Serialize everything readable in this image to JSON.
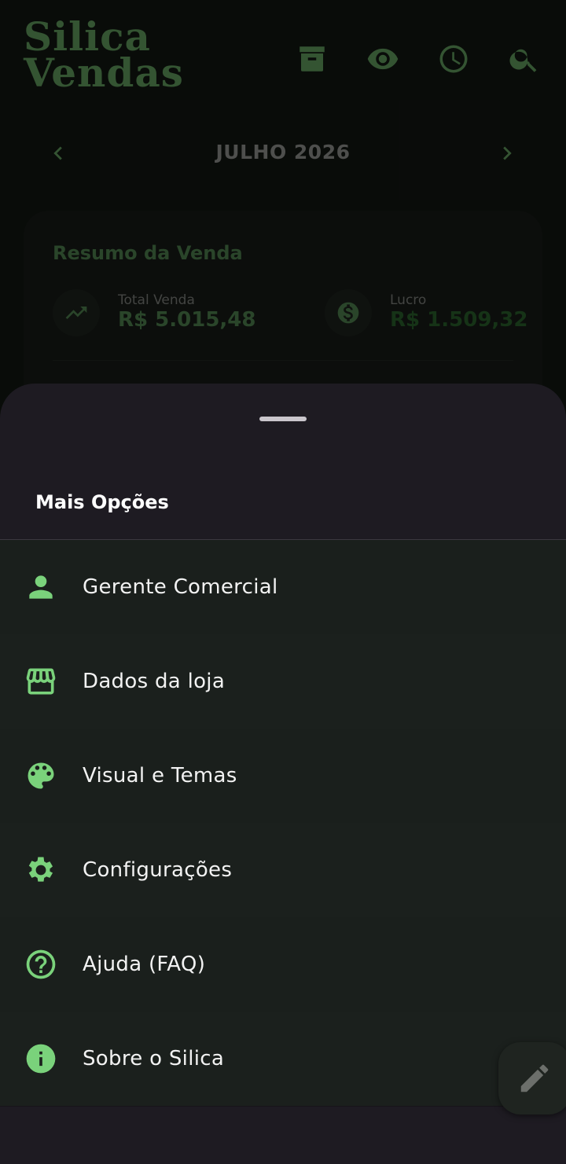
{
  "app": {
    "logo_line1": "Silica",
    "logo_line2": "Vendas",
    "brand_color": "#5f9a5c"
  },
  "top_icons": [
    "archive-icon",
    "eye-icon",
    "clock-icon",
    "search-icon"
  ],
  "month_nav": {
    "label": "JULHO 2026"
  },
  "summary": {
    "title": "Resumo da Venda",
    "total_label": "Total Venda",
    "total_value": "R$ 5.015,48",
    "profit_label": "Lucro",
    "profit_value": "R$ 1.509,32"
  },
  "sheet": {
    "title": "Mais Opções",
    "items": [
      {
        "label": "Gerente Comercial",
        "icon": "person-icon"
      },
      {
        "label": "Dados da loja",
        "icon": "store-icon"
      },
      {
        "label": "Visual e Temas",
        "icon": "palette-icon"
      },
      {
        "label": "Configurações",
        "icon": "gear-icon"
      },
      {
        "label": "Ajuda (FAQ)",
        "icon": "help-icon"
      },
      {
        "label": "Sobre o Silica",
        "icon": "info-icon"
      }
    ],
    "accent_color": "#7ad27b"
  },
  "fab": {
    "icon": "pencil-icon"
  }
}
